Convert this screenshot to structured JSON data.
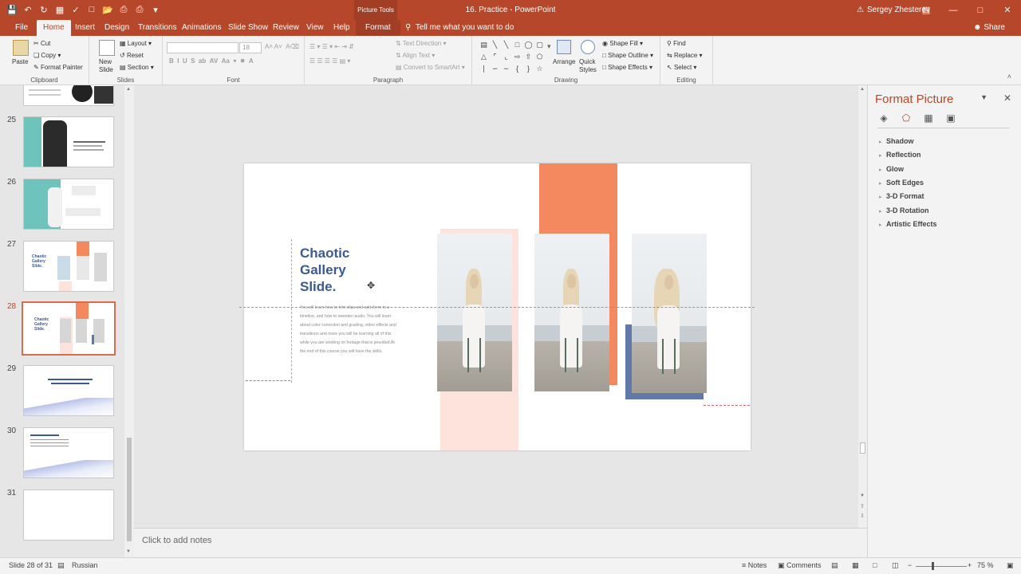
{
  "app": {
    "doc_title": "16. Practice  -  PowerPoint",
    "context_tab_group": "Picture Tools",
    "user": "Sergey Zhesterev",
    "share": "Share",
    "tell_me": "Tell me what you want to do"
  },
  "tabs": [
    "File",
    "Home",
    "Insert",
    "Design",
    "Transitions",
    "Animations",
    "Slide Show",
    "Review",
    "View",
    "Help",
    "Format"
  ],
  "ribbon": {
    "clipboard": {
      "label": "Clipboard",
      "paste": "Paste",
      "cut": "Cut",
      "copy": "Copy",
      "format_painter": "Format Painter"
    },
    "slides": {
      "label": "Slides",
      "new_slide": "New Slide",
      "layout": "Layout",
      "reset": "Reset",
      "section": "Section"
    },
    "font": {
      "label": "Font",
      "size": "18"
    },
    "paragraph": {
      "label": "Paragraph",
      "text_direction": "Text Direction",
      "align_text": "Align Text",
      "convert_smartart": "Convert to SmartArt"
    },
    "drawing": {
      "label": "Drawing",
      "arrange": "Arrange",
      "quick_styles": "Quick Styles",
      "shape_fill": "Shape Fill",
      "shape_outline": "Shape Outline",
      "shape_effects": "Shape Effects"
    },
    "editing": {
      "label": "Editing",
      "find": "Find",
      "replace": "Replace",
      "select": "Select"
    }
  },
  "thumbnails": [
    {
      "num": "25"
    },
    {
      "num": "26"
    },
    {
      "num": "27"
    },
    {
      "num": "28",
      "active": true
    },
    {
      "num": "29"
    },
    {
      "num": "30"
    },
    {
      "num": "31"
    }
  ],
  "slide": {
    "title": "Chaotic\nGallery\nSlide.",
    "body": "You will learn how to trim clips and add them to a timeline, and how to sweeten audio. You will learn about color correction and grading, video effects and transitions and more you will be learning all of this while you are working on footage that is provided.At the end of this course you will have the skills.",
    "accent_orange": "#f4895f",
    "accent_pink": "#fde3db",
    "accent_blue": "#6079a8"
  },
  "notes_placeholder": "Click to add notes",
  "format_pane": {
    "title": "Format Picture",
    "sections": [
      "Shadow",
      "Reflection",
      "Glow",
      "Soft Edges",
      "3-D Format",
      "3-D Rotation",
      "Artistic Effects"
    ]
  },
  "status": {
    "slide_info": "Slide 28 of 31",
    "language": "Russian",
    "notes": "Notes",
    "comments": "Comments",
    "zoom": "75 %"
  }
}
